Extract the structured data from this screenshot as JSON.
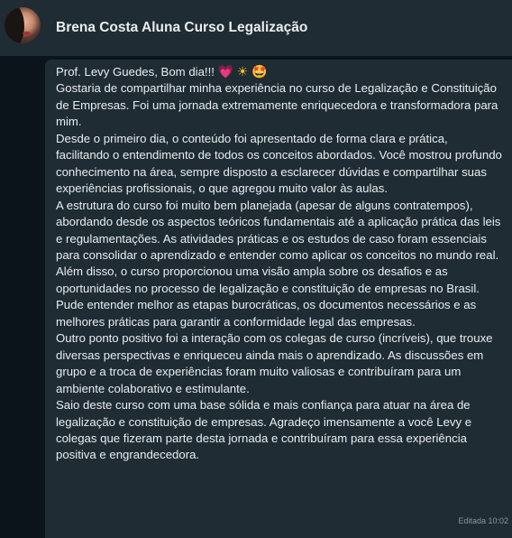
{
  "header": {
    "contact_name": "Brena Costa Aluna Curso Legalização"
  },
  "message": {
    "greeting": "Prof. Levy Guedes, Bom dia!!!",
    "emojis": [
      "💗",
      "☀",
      "🤩"
    ],
    "paragraphs": [
      "Gostaria de compartilhar minha experiência no curso de Legalização e Constituição de Empresas. Foi uma jornada extremamente enriquecedora e transformadora para mim.",
      "Desde o primeiro dia, o conteúdo foi apresentado de forma clara e prática, facilitando o entendimento de todos os conceitos abordados. Você mostrou profundo conhecimento na área, sempre disposto a esclarecer dúvidas e compartilhar suas experiências profissionais, o que agregou muito valor às aulas.",
      "A estrutura do curso foi muito bem planejada (apesar de alguns contratempos), abordando desde os aspectos teóricos fundamentais até a aplicação prática das leis e regulamentações. As atividades práticas e os estudos de caso foram essenciais para consolidar o aprendizado e entender como aplicar os conceitos no mundo real.",
      "Além disso, o curso proporcionou uma visão ampla sobre os desafios e as oportunidades no processo de legalização e constituição de empresas no Brasil. Pude entender melhor as etapas burocráticas, os documentos necessários e as melhores práticas para garantir a conformidade legal das empresas.",
      "Outro ponto positivo foi a interação com os colegas de curso (incríveis), que trouxe diversas perspectivas e enriqueceu ainda mais o aprendizado. As discussões em grupo e a troca de experiências foram muito valiosas e contribuíram para um ambiente colaborativo e estimulante.",
      "Saio deste curso com uma base sólida e mais confiança para atuar na área de legalização e constituição de empresas. Agradeço imensamente a você Levy e colegas que fizeram parte desta jornada e contribuíram para essa experiência positiva e engrandecedora."
    ],
    "meta": "Editada 10:02"
  }
}
